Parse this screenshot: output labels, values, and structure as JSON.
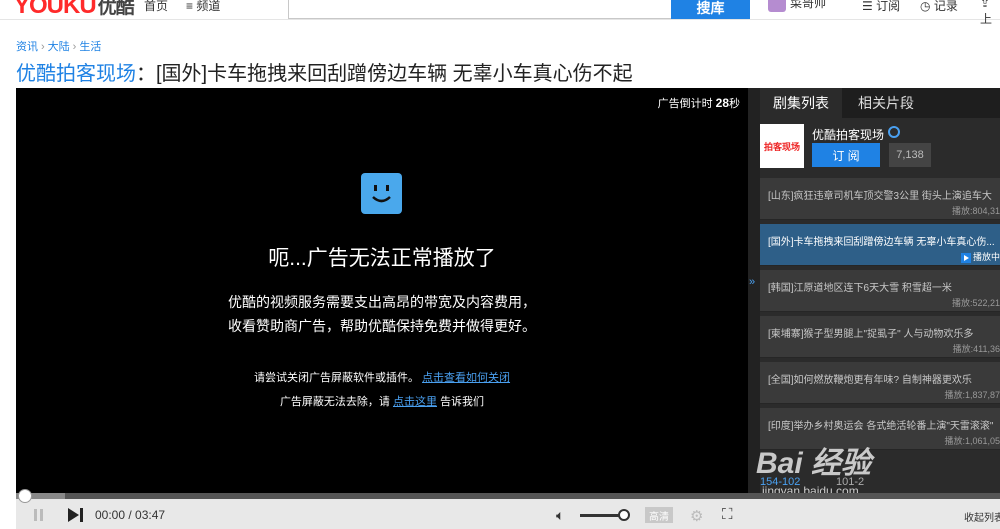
{
  "header": {
    "logo_text": "YOUKU",
    "logo_cn": "优酷",
    "nav_home": "首页",
    "nav_channel": "≡ 频道",
    "search_button": "搜库",
    "username": "菜哥帅",
    "nav_subscribe": "订阅",
    "nav_record": "记录",
    "nav_upload": "上"
  },
  "breadcrumb": [
    "资讯",
    "大陆",
    "生活"
  ],
  "title": {
    "channel": "优酷拍客现场",
    "colon": "：",
    "text": "[国外]卡车拖拽来回刮蹭傍边车辆 无辜小车真心伤不起"
  },
  "player": {
    "countdown_label": "广告倒计时",
    "countdown_value": "28",
    "countdown_unit": "秒",
    "error_title": "呃...广告无法正常播放了",
    "error_line1": "优酷的视频服务需要支出高昂的带宽及内容费用，",
    "error_line2": "收看赞助商广告，帮助优酷保持免费并做得更好。",
    "hint1_text": "请尝试关闭广告屏蔽软件或插件。",
    "hint1_link": "点击查看如何关闭",
    "hint2_text": "广告屏蔽无法去除，请",
    "hint2_link": "点击这里",
    "hint2_tail": "告诉我们"
  },
  "side": {
    "tab_active": "剧集列表",
    "tab_other": "相关片段",
    "channel_logo": "拍客现场",
    "channel_name": "优酷拍客现场",
    "subscribe_label": "订 阅",
    "subscribe_count": "7,138",
    "episodes": [
      {
        "title": "[山东]疯狂违章司机车顶交警3公里 街头上演追车大",
        "plays": "播放:804,31"
      },
      {
        "title": "[国外]卡车拖拽来回刮蹭傍边车辆 无辜小车真心伤...",
        "plays": "播放中"
      },
      {
        "title": "[韩国]江原道地区连下6天大雪 积雪超一米",
        "plays": "播放:522,21"
      },
      {
        "title": "[柬埔寨]猴子型男腿上\"捉虱子\" 人与动物欢乐多",
        "plays": "播放:411,36"
      },
      {
        "title": "[全国]如何燃放鞭炮更有年味? 自制神器更欢乐",
        "plays": "播放:1,837,87"
      },
      {
        "title": "[印度]举办乡村奥运会 各式绝活轮番上演\"天雷滚滚\"",
        "plays": "播放:1,061,05"
      }
    ],
    "pager_active": "154-102",
    "pager_next": "101-2"
  },
  "watermark": {
    "brand": "Bai 经验",
    "url": "jingyan.baidu.com"
  },
  "controls": {
    "time": "00:00 / 03:47",
    "hd_label": "高清",
    "lights_label": "收起列表",
    "progress_buffered": 0.05,
    "volume_level": 0.85
  }
}
